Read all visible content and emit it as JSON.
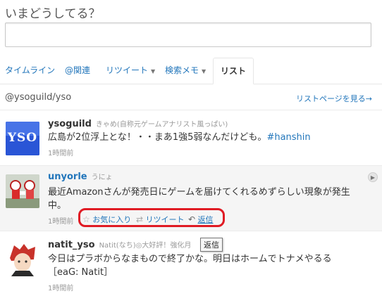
{
  "compose": {
    "prompt": "いまどうしてる？"
  },
  "tabs": [
    {
      "label": "タイムライン",
      "caret": ""
    },
    {
      "label": "@関連",
      "caret": ""
    },
    {
      "label": "リツイート",
      "caret": "▼"
    },
    {
      "label": "検索メモ",
      "caret": "▼"
    },
    {
      "label": "リスト",
      "caret": ""
    }
  ],
  "list": {
    "name": "@ysoguild/yso",
    "page_link": "リストページを見る→"
  },
  "tweets": [
    {
      "screen_name": "ysoguild",
      "full_name": "きゃめ(自称元ゲームアナリスト風っぱい)",
      "avatar_text": "YSO",
      "text_main": "広島が2位浮上とな！・・まあ1強5弱なんだけども。",
      "hashtag": "#hanshin",
      "time": "1時間前"
    },
    {
      "screen_name": "unyorle",
      "full_name": "うにょ",
      "text_line1": "最近Amazonさんが発売日にゲームを届けてくれるめずらしい現象が発生",
      "text_line2": "中。",
      "time": "1時間前",
      "actions": {
        "favorite": "お気に入り",
        "retweet": "リツイート",
        "reply": "返信"
      },
      "more": "▶"
    },
    {
      "screen_name": "natit_yso",
      "full_name": "Natit(なち)◎大好評！強化月",
      "text_line1": "今日はプラボからなまもので終了かな。明日はホームでトナメやるる",
      "text_line2": "［eaG: Natit］",
      "time": "1時間前"
    }
  ],
  "tooltip": {
    "text": "返信"
  },
  "colors": {
    "link": "#2276bb",
    "highlight_box": "#e01b24",
    "avatar_yso": "#2a55d6"
  }
}
